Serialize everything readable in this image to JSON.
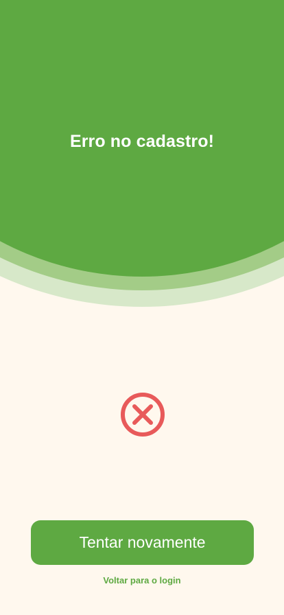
{
  "header": {
    "title": "Erro no cadastro!"
  },
  "status": {
    "icon": "error-x-circle-icon",
    "color": "#e85a5a"
  },
  "actions": {
    "retry_label": "Tentar novamente",
    "back_label": "Voltar para o login"
  },
  "colors": {
    "primary": "#5ea942",
    "primary_light": "#a3cc87",
    "primary_lighter": "#d7e8c9",
    "background": "#fff8ee",
    "error": "#e85a5a"
  }
}
